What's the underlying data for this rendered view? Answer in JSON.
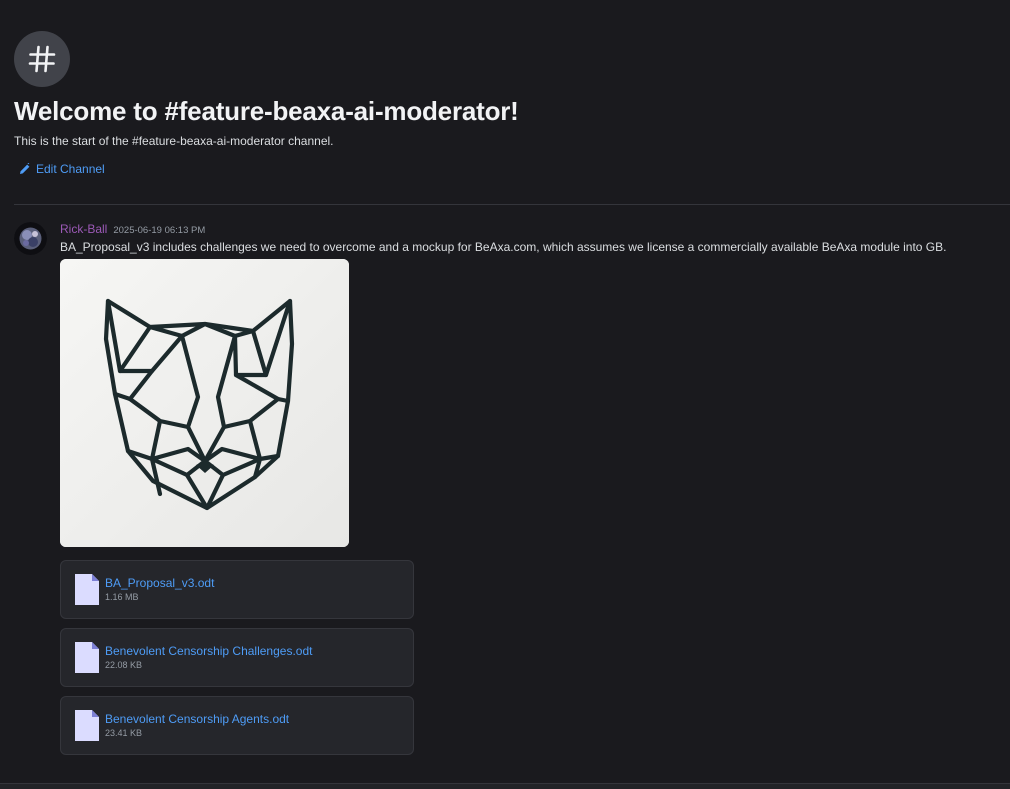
{
  "channel": {
    "welcome_title": "Welcome to #feature-beaxa-ai-moderator!",
    "welcome_subtitle": "This is the start of the #feature-beaxa-ai-moderator channel.",
    "edit_label": "Edit Channel",
    "icon": "hash-icon"
  },
  "message": {
    "author": "Rick-Ball",
    "author_color": "#9b59b6",
    "timestamp": "2025-06-19 06:13 PM",
    "text": "BA_Proposal_v3 includes challenges we need to overcome and a mockup for BeAxa.com, which assumes we license a commercially available BeAxa module into GB.",
    "image_alt": "geometric-cat-head-artwork",
    "attachments": [
      {
        "name": "BA_Proposal_v3.odt",
        "size": "1.16 MB",
        "icon": "file-icon"
      },
      {
        "name": "Benevolent Censorship Challenges.odt",
        "size": "22.08 KB",
        "icon": "file-icon"
      },
      {
        "name": "Benevolent Censorship Agents.odt",
        "size": "23.41 KB",
        "icon": "file-icon"
      }
    ]
  },
  "colors": {
    "background": "#1a1a1e",
    "link": "#4e9cf6",
    "file_card": "#25262b"
  }
}
